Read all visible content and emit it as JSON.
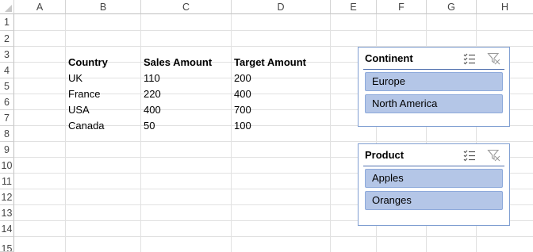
{
  "columns": [
    "A",
    "B",
    "C",
    "D",
    "E",
    "F",
    "G",
    "H"
  ],
  "rows": [
    "1",
    "2",
    "3",
    "4",
    "5",
    "6",
    "7",
    "8",
    "9",
    "10",
    "11",
    "12",
    "13",
    "14",
    "15"
  ],
  "table": {
    "headers": [
      "Country",
      "Sales Amount",
      "Target Amount"
    ],
    "rows": [
      [
        "UK",
        "110",
        "200"
      ],
      [
        "France",
        "220",
        "400"
      ],
      [
        "USA",
        "400",
        "700"
      ],
      [
        "Canada",
        "50",
        "100"
      ]
    ]
  },
  "slicers": [
    {
      "title": "Continent",
      "items": [
        "Europe",
        "North America"
      ]
    },
    {
      "title": "Product",
      "items": [
        "Apples",
        "Oranges"
      ]
    }
  ],
  "colors": {
    "slicer_item_fill": "#b4c6e7",
    "slicer_border": "#7f9ed1",
    "gridline": "#e1e1e1"
  },
  "icons": {
    "multiselect": "multi-select-icon",
    "clear_filter": "clear-filter-icon"
  }
}
